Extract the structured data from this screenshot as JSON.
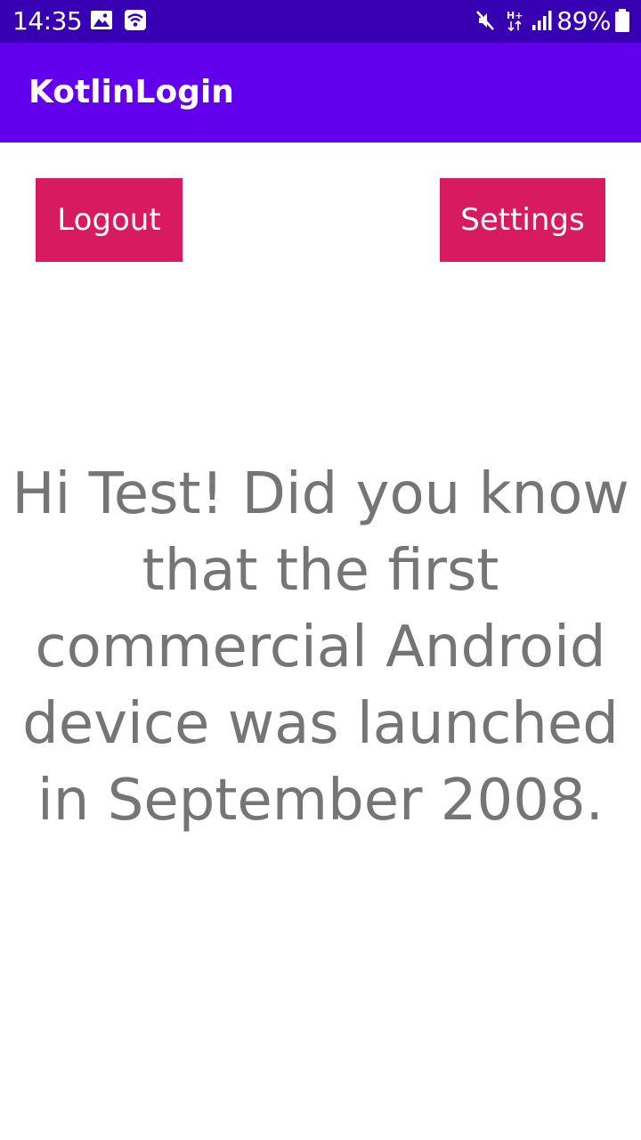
{
  "status_bar": {
    "time": "14:35",
    "battery_percent": "89%",
    "network_type": "H+",
    "icons": [
      "gallery-icon",
      "wifi-icon",
      "mute-icon",
      "data-arrows-icon",
      "signal-icon",
      "battery-icon"
    ]
  },
  "app_bar": {
    "title": "KotlinLogin"
  },
  "buttons": {
    "logout_label": "Logout",
    "settings_label": "Settings"
  },
  "main": {
    "message": "Hi Test! Did you know that the first commercial Android device was launched in September 2008."
  },
  "colors": {
    "status_bar": "#3700B3",
    "app_bar": "#6200EE",
    "accent_button": "#D81B60",
    "message_text": "#757575"
  }
}
